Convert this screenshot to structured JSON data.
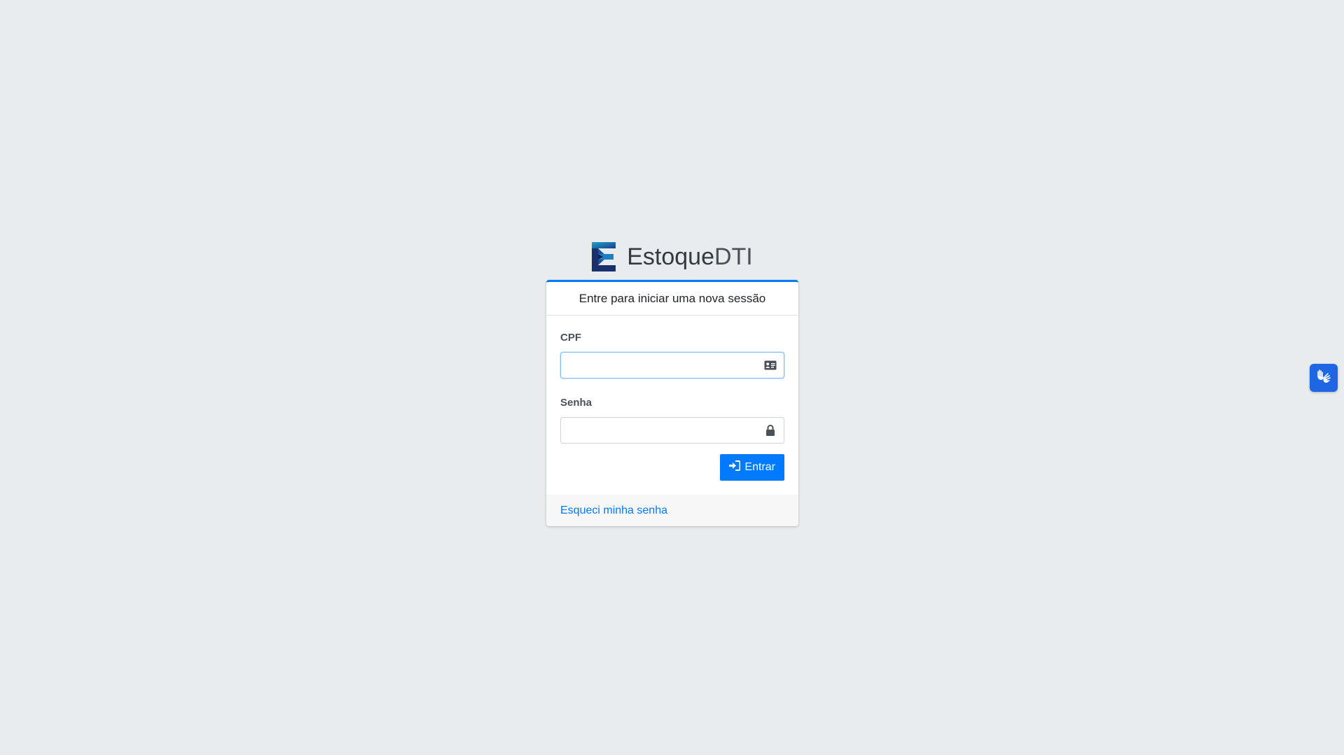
{
  "brand": {
    "name_bold": "Estoque",
    "name_light": "DTI",
    "logo_icon": "estoque-e-logo"
  },
  "card": {
    "header": "Entre para iniciar uma nova sessão",
    "accent_color": "#007bff"
  },
  "form": {
    "cpf": {
      "label": "CPF",
      "value": "",
      "placeholder": "",
      "icon": "id-card-icon"
    },
    "senha": {
      "label": "Senha",
      "value": "",
      "placeholder": "",
      "icon": "lock-icon"
    },
    "submit_label": "Entrar",
    "submit_icon": "sign-in-icon"
  },
  "footer": {
    "forgot_password": "Esqueci minha senha"
  },
  "accessibility_widget": {
    "icon": "sign-language-hands-icon",
    "color": "#1f66e5"
  }
}
